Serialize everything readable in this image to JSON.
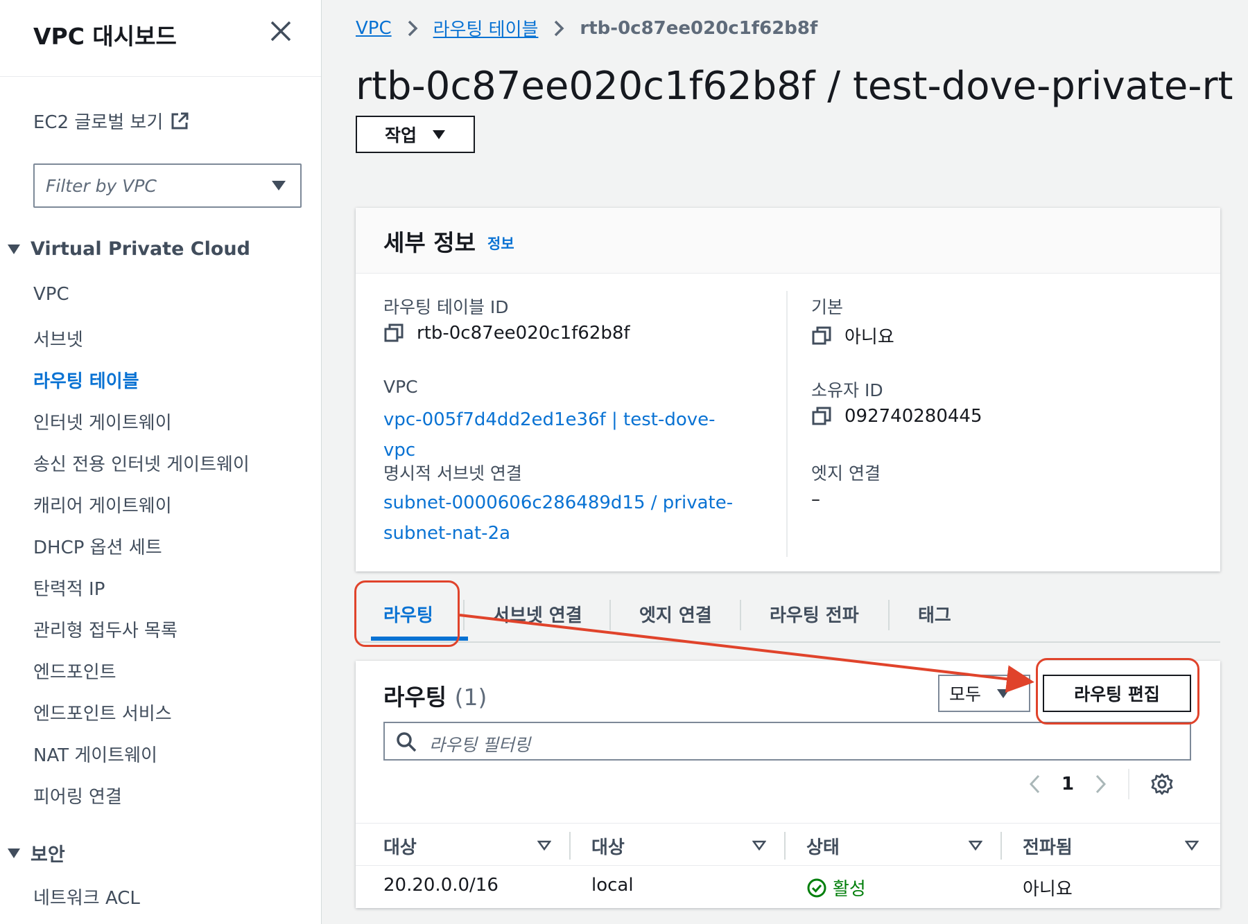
{
  "sidebar": {
    "title": "VPC 대시보드",
    "ec2_link": "EC2 글로벌 보기",
    "filter_placeholder": "Filter by VPC",
    "section_vpc": "Virtual Private Cloud",
    "items": [
      "VPC",
      "서브넷",
      "라우팅 테이블",
      "인터넷 게이트웨이",
      "송신 전용 인터넷 게이트웨이",
      "캐리어 게이트웨이",
      "DHCP 옵션 세트",
      "탄력적 IP",
      "관리형 접두사 목록",
      "엔드포인트",
      "엔드포인트 서비스",
      "NAT 게이트웨이",
      "피어링 연결"
    ],
    "active_item": "라우팅 테이블",
    "section_security": "보안",
    "security_items": [
      "네트워크 ACL"
    ]
  },
  "breadcrumb": {
    "items": [
      "VPC",
      "라우팅 테이블"
    ],
    "current": "rtb-0c87ee020c1f62b8f"
  },
  "page": {
    "title": "rtb-0c87ee020c1f62b8f / test-dove-private-rt",
    "actions_label": "작업"
  },
  "details": {
    "title": "세부 정보",
    "info_link": "정보",
    "route_table_id_label": "라우팅 테이블 ID",
    "route_table_id": "rtb-0c87ee020c1f62b8f",
    "main_label": "기본",
    "main_value": "아니요",
    "vpc_label": "VPC",
    "vpc_value": "vpc-005f7d4dd2ed1e36f | test-dove-vpc",
    "owner_label": "소유자 ID",
    "owner_value": "092740280445",
    "subnet_assoc_label": "명시적 서브넷 연결",
    "subnet_assoc_value": "subnet-0000606c286489d15 / private-subnet-nat-2a",
    "edge_assoc_label": "엣지 연결",
    "edge_assoc_value": "–"
  },
  "tabs": [
    "라우팅",
    "서브넷 연결",
    "엣지 연결",
    "라우팅 전파",
    "태그"
  ],
  "routes": {
    "title": "라우팅",
    "count": "(1)",
    "filter_select": "모두",
    "edit_button": "라우팅 편집",
    "search_placeholder": "라우팅 필터링",
    "page": "1",
    "columns": [
      "대상",
      "대상",
      "상태",
      "전파됨"
    ],
    "rows": [
      {
        "destination": "20.20.0.0/16",
        "target": "local",
        "status": "활성",
        "propagated": "아니요"
      }
    ]
  },
  "colors": {
    "link": "#0972d3",
    "annotation": "#e0432b",
    "status_ok": "#037f0c"
  }
}
